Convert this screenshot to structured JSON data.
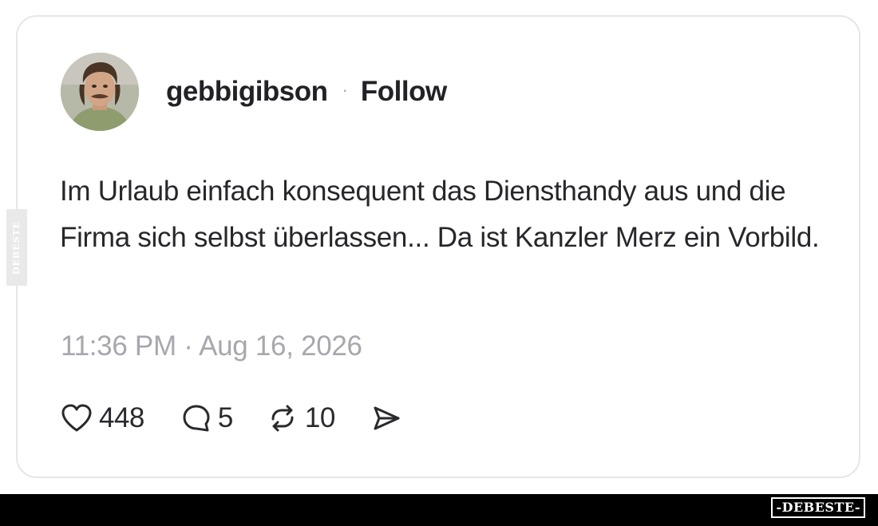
{
  "post": {
    "username": "gebbigibson",
    "separator": "·",
    "follow_label": "Follow",
    "text": "Im Urlaub einfach konsequent das Diensthandy aus und die Firma sich selbst überlassen... Da ist Kanzler Merz ein Vorbild.",
    "timestamp": "11:36 PM · Aug 16, 2026",
    "actions": {
      "like_icon": "heart-icon",
      "like_count": "448",
      "reply_icon": "comment-bubble-icon",
      "reply_count": "5",
      "repost_icon": "repost-arrows-icon",
      "repost_count": "10",
      "share_icon": "send-arrow-icon"
    }
  },
  "watermark": {
    "side_text": "DEBESTE",
    "footer_logo": "-DEBESTE-"
  },
  "colors": {
    "card_border": "#e6e6e8",
    "text_primary": "#27272b",
    "text_muted": "#a7a7ad",
    "footer_bar": "#000000"
  }
}
